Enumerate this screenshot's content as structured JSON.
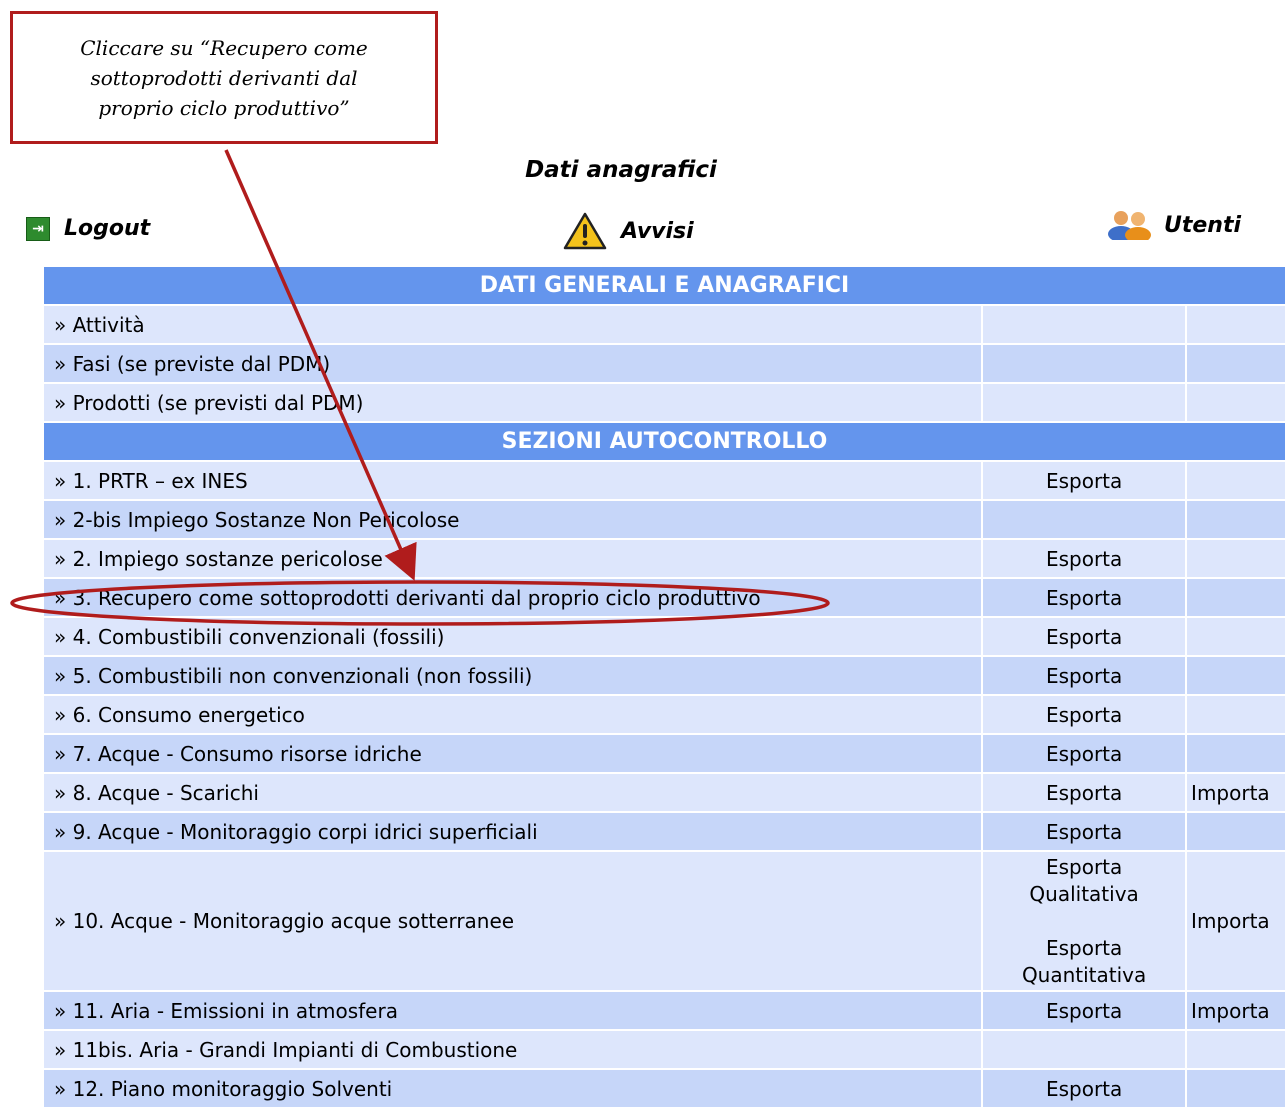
{
  "callout": {
    "text": "Cliccare su “Recupero come sottoprodotti derivanti dal proprio ciclo produttivo”"
  },
  "page": {
    "title": "Dati anagrafici"
  },
  "nav": {
    "logout": "Logout",
    "avvisi": "Avvisi",
    "utenti": "Utenti"
  },
  "sections": {
    "general": "DATI GENERALI E ANAGRAFICI",
    "autocontrollo": "SEZIONI AUTOCONTROLLO"
  },
  "general_rows": [
    {
      "label": "» Attività"
    },
    {
      "label": "» Fasi (se previste dal PDM)"
    },
    {
      "label": "» Prodotti (se previsti dal PDM)"
    }
  ],
  "auto_rows": [
    {
      "label": "» 1. PRTR – ex INES",
      "export": "Esporta",
      "import": ""
    },
    {
      "label": "» 2-bis Impiego Sostanze Non Pericolose",
      "export": "",
      "import": ""
    },
    {
      "label": "» 2. Impiego sostanze pericolose",
      "export": "Esporta",
      "import": ""
    },
    {
      "label": "» 3. Recupero come sottoprodotti derivanti dal proprio ciclo produttivo",
      "export": "Esporta",
      "import": ""
    },
    {
      "label": "» 4. Combustibili convenzionali (fossili)",
      "export": "Esporta",
      "import": ""
    },
    {
      "label": "» 5. Combustibili non convenzionali (non fossili)",
      "export": "Esporta",
      "import": ""
    },
    {
      "label": "» 6. Consumo energetico",
      "export": "Esporta",
      "import": ""
    },
    {
      "label": "» 7. Acque - Consumo risorse idriche",
      "export": "Esporta",
      "import": ""
    },
    {
      "label": "» 8. Acque - Scarichi",
      "export": "Esporta",
      "import": "Importa"
    },
    {
      "label": "» 9. Acque - Monitoraggio corpi idrici superficiali",
      "export": "Esporta",
      "import": ""
    },
    {
      "label": "» 10. Acque - Monitoraggio acque sotterranee",
      "export_qual": "Esporta Qualitativa",
      "export_quant": "Esporta Quantitativa",
      "import": "Importa"
    },
    {
      "label": "» 11. Aria - Emissioni in atmosfera",
      "export": "Esporta",
      "import": "Importa"
    },
    {
      "label": "» 11bis. Aria - Grandi Impianti di Combustione",
      "export": "",
      "import": ""
    },
    {
      "label": "» 12. Piano monitoraggio Solventi",
      "export": "Esporta",
      "import": ""
    }
  ],
  "colors": {
    "section_bg": "#6495ed",
    "row_a": "#dde6fc",
    "row_b": "#c6d6f9",
    "annotation": "#b01c1c"
  }
}
